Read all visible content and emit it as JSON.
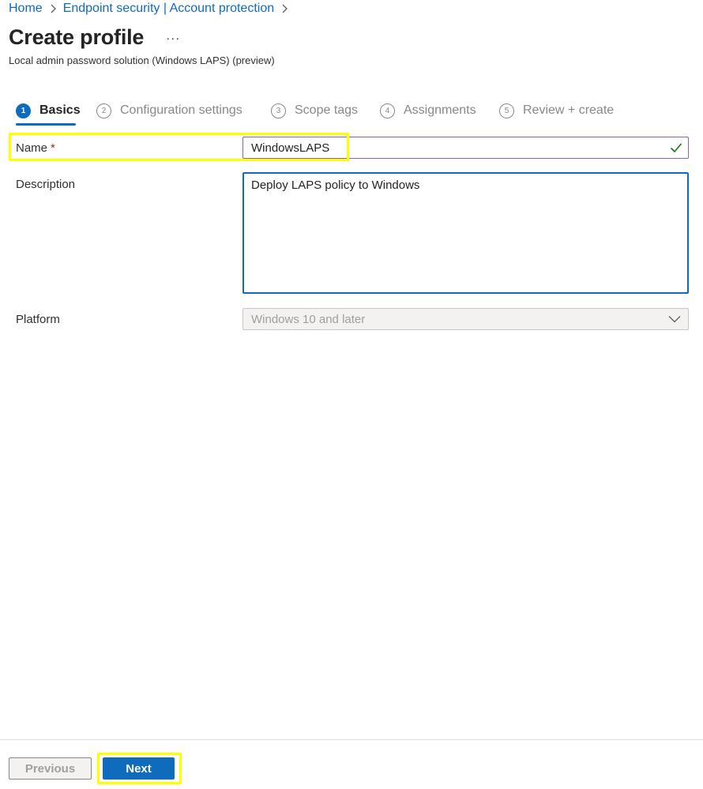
{
  "breadcrumb": {
    "items": [
      "Home",
      "Endpoint security | Account protection"
    ]
  },
  "header": {
    "title": "Create profile",
    "more_label": "···",
    "subtitle": "Local admin password solution (Windows LAPS) (preview)"
  },
  "wizard": {
    "steps": [
      {
        "number": "1",
        "label": "Basics",
        "active": true
      },
      {
        "number": "2",
        "label": "Configuration settings",
        "active": false
      },
      {
        "number": "3",
        "label": "Scope tags",
        "active": false
      },
      {
        "number": "4",
        "label": "Assignments",
        "active": false
      },
      {
        "number": "5",
        "label": "Review + create",
        "active": false
      }
    ]
  },
  "form": {
    "name": {
      "label": "Name",
      "required_mark": "*",
      "value": "WindowsLAPS",
      "valid_icon": "checkmark-icon"
    },
    "description": {
      "label": "Description",
      "value": "Deploy LAPS policy to Windows"
    },
    "platform": {
      "label": "Platform",
      "value": "Windows 10 and later",
      "icon": "chevron-down-icon"
    }
  },
  "footer": {
    "previous_label": "Previous",
    "next_label": "Next"
  },
  "colors": {
    "accent": "#0f6cbd",
    "link": "#0f6cbd",
    "valid_check": "#107c10",
    "name_border": "#8764b8",
    "highlight": "#ffff00",
    "required": "#a4262c"
  }
}
